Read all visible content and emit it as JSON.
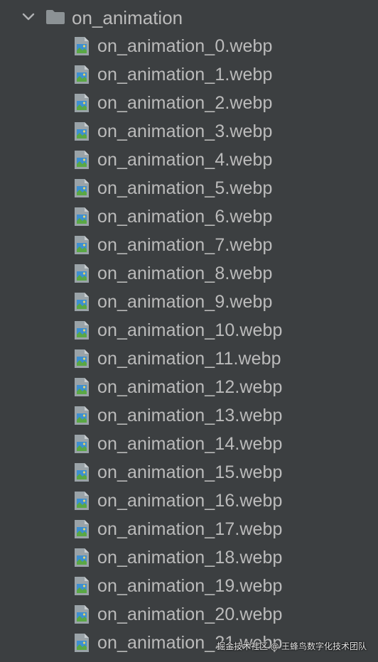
{
  "folder": {
    "name": "on_animation",
    "expanded": true,
    "icon": "folder-icon",
    "chevron_icon": "chevron-down-icon"
  },
  "files": [
    {
      "name": "on_animation_0.webp",
      "icon": "image-file-icon"
    },
    {
      "name": "on_animation_1.webp",
      "icon": "image-file-icon"
    },
    {
      "name": "on_animation_2.webp",
      "icon": "image-file-icon"
    },
    {
      "name": "on_animation_3.webp",
      "icon": "image-file-icon"
    },
    {
      "name": "on_animation_4.webp",
      "icon": "image-file-icon"
    },
    {
      "name": "on_animation_5.webp",
      "icon": "image-file-icon"
    },
    {
      "name": "on_animation_6.webp",
      "icon": "image-file-icon"
    },
    {
      "name": "on_animation_7.webp",
      "icon": "image-file-icon"
    },
    {
      "name": "on_animation_8.webp",
      "icon": "image-file-icon"
    },
    {
      "name": "on_animation_9.webp",
      "icon": "image-file-icon"
    },
    {
      "name": "on_animation_10.webp",
      "icon": "image-file-icon"
    },
    {
      "name": "on_animation_11.webp",
      "icon": "image-file-icon"
    },
    {
      "name": "on_animation_12.webp",
      "icon": "image-file-icon"
    },
    {
      "name": "on_animation_13.webp",
      "icon": "image-file-icon"
    },
    {
      "name": "on_animation_14.webp",
      "icon": "image-file-icon"
    },
    {
      "name": "on_animation_15.webp",
      "icon": "image-file-icon"
    },
    {
      "name": "on_animation_16.webp",
      "icon": "image-file-icon"
    },
    {
      "name": "on_animation_17.webp",
      "icon": "image-file-icon"
    },
    {
      "name": "on_animation_18.webp",
      "icon": "image-file-icon"
    },
    {
      "name": "on_animation_19.webp",
      "icon": "image-file-icon"
    },
    {
      "name": "on_animation_20.webp",
      "icon": "image-file-icon"
    },
    {
      "name": "on_animation_21.webp",
      "icon": "image-file-icon"
    }
  ],
  "watermark": "掘金技术社区 @ 王蜂鸟数字化技术团队",
  "colors": {
    "background": "#3c3f41",
    "text": "#bbbbbb",
    "folder": "#8c9295",
    "file_page": "#9aa3a8",
    "image_sky": "#3d8fd1",
    "image_hill": "#5aa845"
  }
}
